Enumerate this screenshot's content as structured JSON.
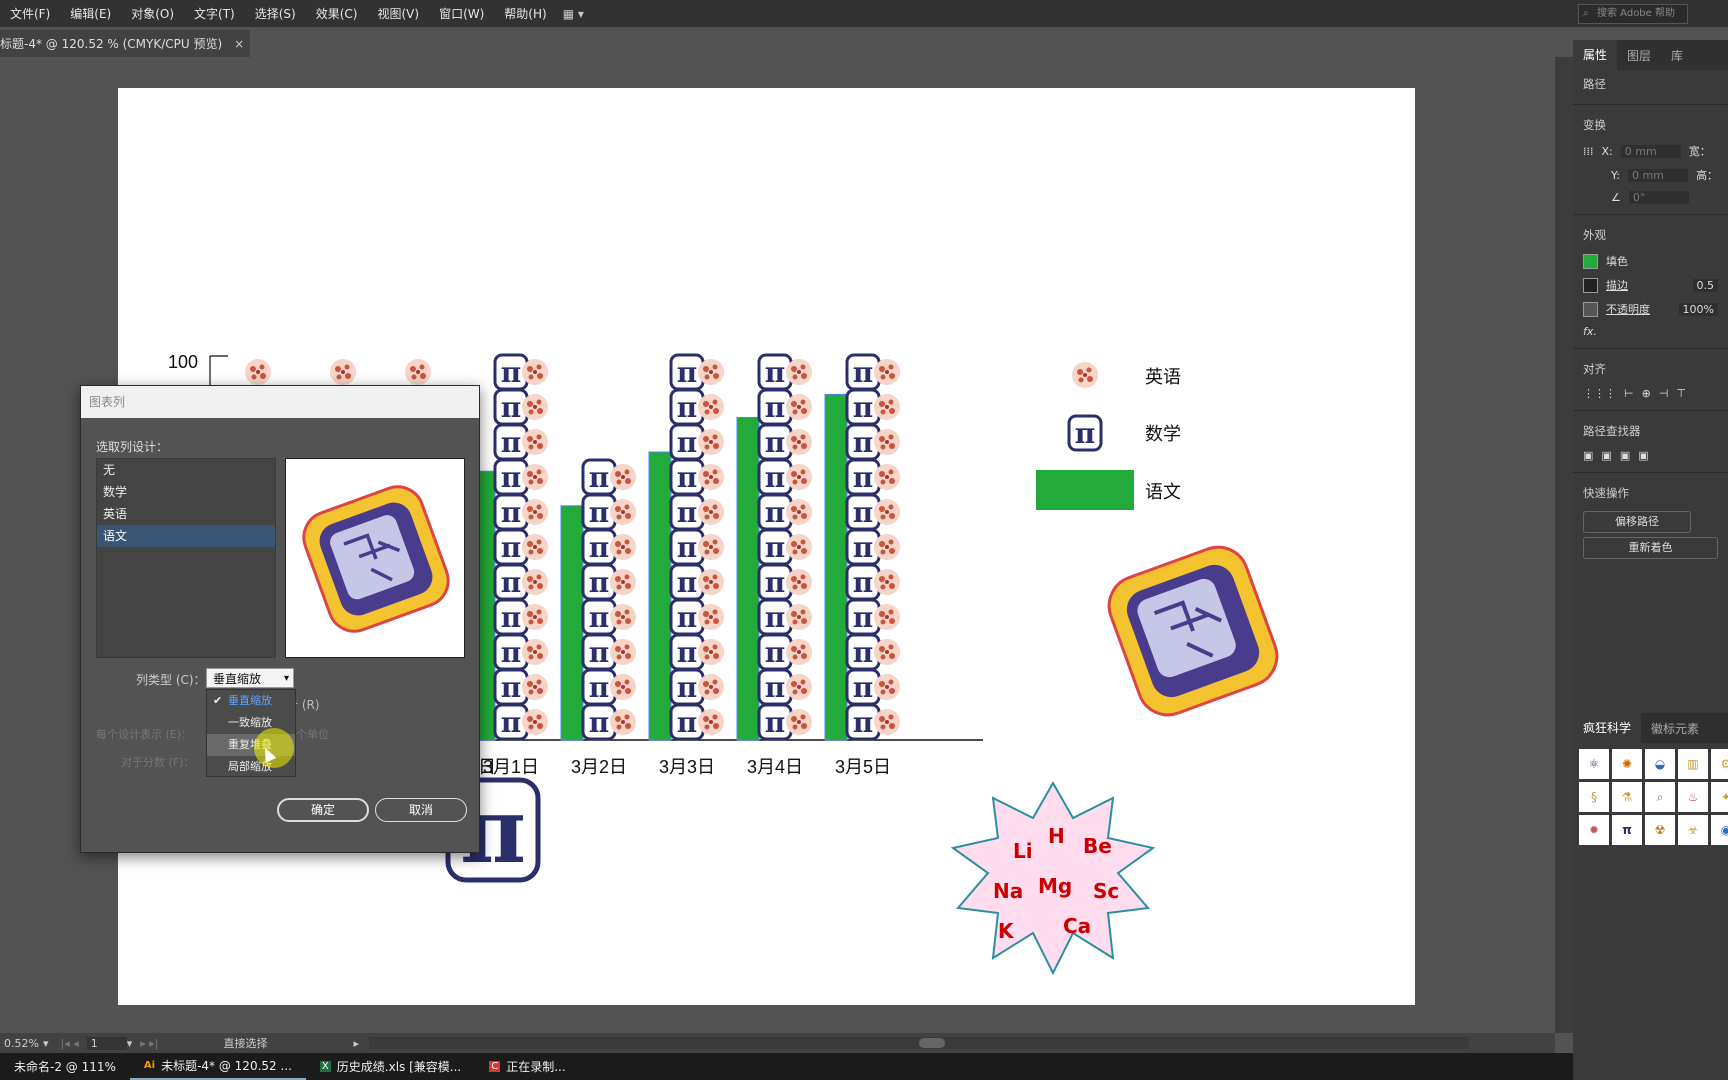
{
  "menubar": {
    "items": [
      "文件(F)",
      "编辑(E)",
      "对象(O)",
      "文字(T)",
      "选择(S)",
      "效果(C)",
      "视图(V)",
      "窗口(W)",
      "帮助(H)"
    ],
    "search_placeholder": "搜索 Adobe 帮助"
  },
  "document_tab": {
    "title": "标题-4* @ 120.52 % (CMYK/CPU 预览)",
    "close": "×"
  },
  "chart_data": {
    "type": "bar",
    "categories": [
      "3月1日",
      "3月2日",
      "3月3日",
      "3月4日",
      "3月5日"
    ],
    "hidden_category_suffix": "日",
    "y_tick_label": "100",
    "series": [
      {
        "name": "英语",
        "color": "#c8553d"
      },
      {
        "name": "数学",
        "color": "#2a2f6b"
      },
      {
        "name": "语文",
        "color": "#22aa3a",
        "values": [
          70,
          61,
          75,
          84,
          90
        ]
      }
    ],
    "ylim": [
      0,
      100
    ],
    "legend_position": "right"
  },
  "dialog": {
    "title": "图表列",
    "design_label": "选取列设计：",
    "designs": [
      "无",
      "数学",
      "英语",
      "语文"
    ],
    "selected_design": "语文",
    "column_type_label": "列类型 (C)：",
    "column_type_value": "垂直缩放",
    "column_type_options": [
      "垂直缩放",
      "一致缩放",
      "重复堆叠",
      "局部缩放"
    ],
    "hovered_option": "重复堆叠",
    "row_r_text": "计 (R)",
    "each_design_label": "每个设计表示 (E)：",
    "each_design_unit": "个单位",
    "fraction_label": "对于分数 (F)：",
    "ok_label": "确定",
    "cancel_label": "取消"
  },
  "right_panel": {
    "tabs": [
      "属性",
      "图层",
      "库"
    ],
    "path_label": "路径",
    "transform_label": "变换",
    "x_label": "X:",
    "y_label": "Y:",
    "x_value": "0 mm",
    "y_value": "0 mm",
    "w_label": "宽：",
    "h_label": "高：",
    "angle_value": "0°",
    "appearance_label": "外观",
    "fill_label": "填色",
    "fill_color": "#22aa3a",
    "stroke_label": "描边",
    "stroke_value": "0.5",
    "opacity_label": "不透明度",
    "opacity_value": "100%",
    "fx_label": "fx.",
    "align_label": "对齐",
    "pathfinder_label": "路径查找器",
    "quick_actions_label": "快速操作",
    "offset_path_label": "偏移路径",
    "recolor_label": "重新着色",
    "symbols_tabs": [
      "疯狂科学",
      "徽标元素"
    ]
  },
  "statusbar": {
    "zoom": "0.52%",
    "page": "1",
    "tool": "直接选择"
  },
  "taskbar": {
    "items": [
      "未命名-2 @ 111%",
      "未标题-4* @ 120.52 ...",
      "历史成绩.xls [兼容模...",
      "正在录制..."
    ]
  }
}
